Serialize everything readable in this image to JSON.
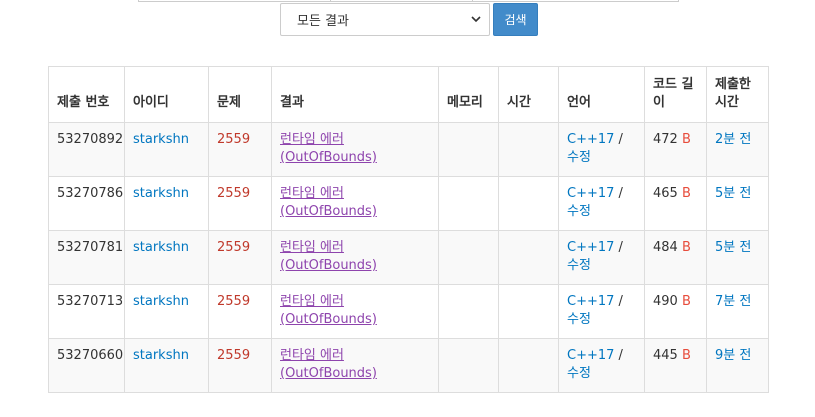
{
  "filter": {
    "result_select": "모든 결과",
    "search_label": "검색"
  },
  "table": {
    "headers": [
      "제출 번호",
      "아이디",
      "문제",
      "결과",
      "메모리",
      "시간",
      "언어",
      "코드 길이",
      "제출한 시간"
    ],
    "rows": [
      {
        "id": "53270892",
        "user": "starkshn",
        "problem": "2559",
        "result": "런타임 에러 (OutOfBounds)",
        "memory": "",
        "time": "",
        "lang": "C++17",
        "lang_edit": "수정",
        "code_len": "472",
        "code_unit": "B",
        "submitted": "2분 전"
      },
      {
        "id": "53270786",
        "user": "starkshn",
        "problem": "2559",
        "result": "런타임 에러 (OutOfBounds)",
        "memory": "",
        "time": "",
        "lang": "C++17",
        "lang_edit": "수정",
        "code_len": "465",
        "code_unit": "B",
        "submitted": "5분 전"
      },
      {
        "id": "53270781",
        "user": "starkshn",
        "problem": "2559",
        "result": "런타임 에러 (OutOfBounds)",
        "memory": "",
        "time": "",
        "lang": "C++17",
        "lang_edit": "수정",
        "code_len": "484",
        "code_unit": "B",
        "submitted": "5분 전"
      },
      {
        "id": "53270713",
        "user": "starkshn",
        "problem": "2559",
        "result": "런타임 에러 (OutOfBounds)",
        "memory": "",
        "time": "",
        "lang": "C++17",
        "lang_edit": "수정",
        "code_len": "490",
        "code_unit": "B",
        "submitted": "7분 전"
      },
      {
        "id": "53270660",
        "user": "starkshn",
        "problem": "2559",
        "result": "런타임 에러 (OutOfBounds)",
        "memory": "",
        "time": "",
        "lang": "C++17",
        "lang_edit": "수정",
        "code_len": "445",
        "code_unit": "B",
        "submitted": "9분 전"
      }
    ]
  },
  "icons": {
    "select_chevron": "chevron-down-icon"
  }
}
